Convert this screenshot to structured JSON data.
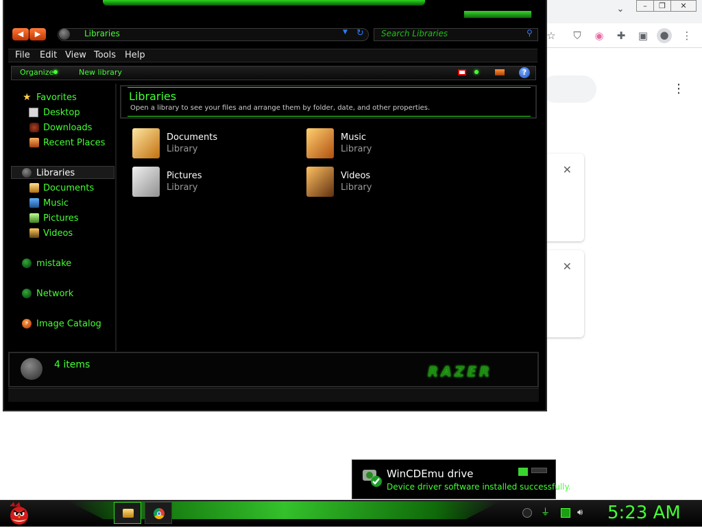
{
  "explorer": {
    "address": "Libraries",
    "search_placeholder": "Search Libraries",
    "menu": [
      "File",
      "Edit",
      "View",
      "Tools",
      "Help"
    ],
    "commands": {
      "organize": "Organize",
      "new_library": "New library"
    },
    "nav": {
      "favorites": "Favorites",
      "desktop": "Desktop",
      "downloads": "Downloads",
      "recent": "Recent Places",
      "libraries": "Libraries",
      "documents": "Documents",
      "music": "Music",
      "pictures": "Pictures",
      "videos": "Videos",
      "mistake": "mistake",
      "network": "Network",
      "image_catalog": "Image Catalog"
    },
    "header": {
      "title": "Libraries",
      "subtitle": "Open a library to see your files and arrange them by folder, date, and other properties."
    },
    "libraries": [
      {
        "name": "Documents",
        "type": "Library"
      },
      {
        "name": "Music",
        "type": "Library"
      },
      {
        "name": "Pictures",
        "type": "Library"
      },
      {
        "name": "Videos",
        "type": "Library"
      }
    ],
    "details": {
      "count": "4 items",
      "logo": "RAZER"
    }
  },
  "notification": {
    "title": "WinCDEmu drive",
    "message": "Device driver software installed successfully."
  },
  "taskbar": {
    "clock": "5:23 AM"
  },
  "colors": {
    "accent": "#44ff33",
    "background": "#000000"
  }
}
